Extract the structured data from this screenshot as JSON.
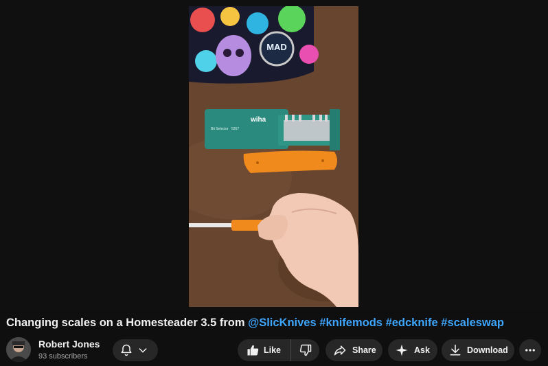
{
  "video": {
    "title_main": "Changing scales on a Homesteader 3.5 from ",
    "title_tags": [
      "@SlicKnives",
      "#knifemods",
      "#edcknife",
      "#scaleswap"
    ],
    "frame_text": {
      "brand": "wiha",
      "product": "Bit Selector",
      "product_code": "5267",
      "sticker": "MAD"
    }
  },
  "channel": {
    "name": "Robert Jones",
    "subscribers": "93 subscribers"
  },
  "actions": {
    "like_label": "Like",
    "share_label": "Share",
    "ask_label": "Ask",
    "download_label": "Download"
  },
  "colors": {
    "background": "#0f0f0f",
    "pill": "#272727",
    "hashtag": "#3ea6ff",
    "secondary_text": "#aaaaaa"
  },
  "icons": [
    "bell-icon",
    "chevron-down-icon",
    "thumbs-up-icon",
    "thumbs-down-icon",
    "share-arrow-icon",
    "sparkle-icon",
    "download-icon",
    "more-vert-icon"
  ]
}
